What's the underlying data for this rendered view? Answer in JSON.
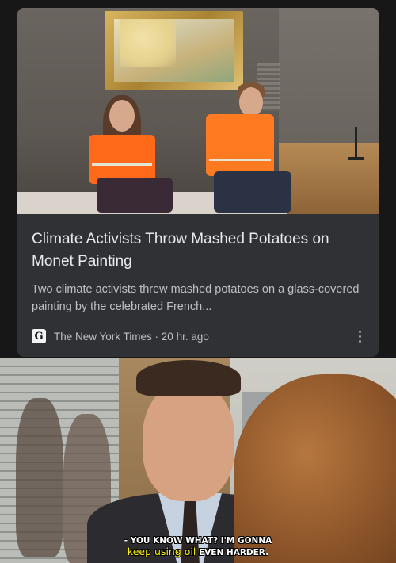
{
  "news_card": {
    "headline": "Climate Activists Throw Mashed Potatoes on Monet Painting",
    "snippet": "Two climate activists threw mashed potatoes on a glass-covered painting by the celebrated French...",
    "source": {
      "icon": "new-york-times-logo-icon",
      "logo_glyph": "G",
      "name": "The New York Times · 20 hr. ago"
    },
    "more_options": "kebab-menu-icon",
    "image": "photo-of-two-activists-in-orange-vests-below-monet-painting"
  },
  "meme": {
    "image": "office-scene-man-in-suit-frowning-at-woman",
    "caption_line1": "- YOU KNOW WHAT? I'M GONNA",
    "caption_edit": "keep using oil",
    "caption_line2_end": " EVEN HARDER."
  },
  "colors": {
    "card_bg": "#303134",
    "vest_orange": "#ff6a1a",
    "caption_edit_yellow": "#fff200"
  }
}
